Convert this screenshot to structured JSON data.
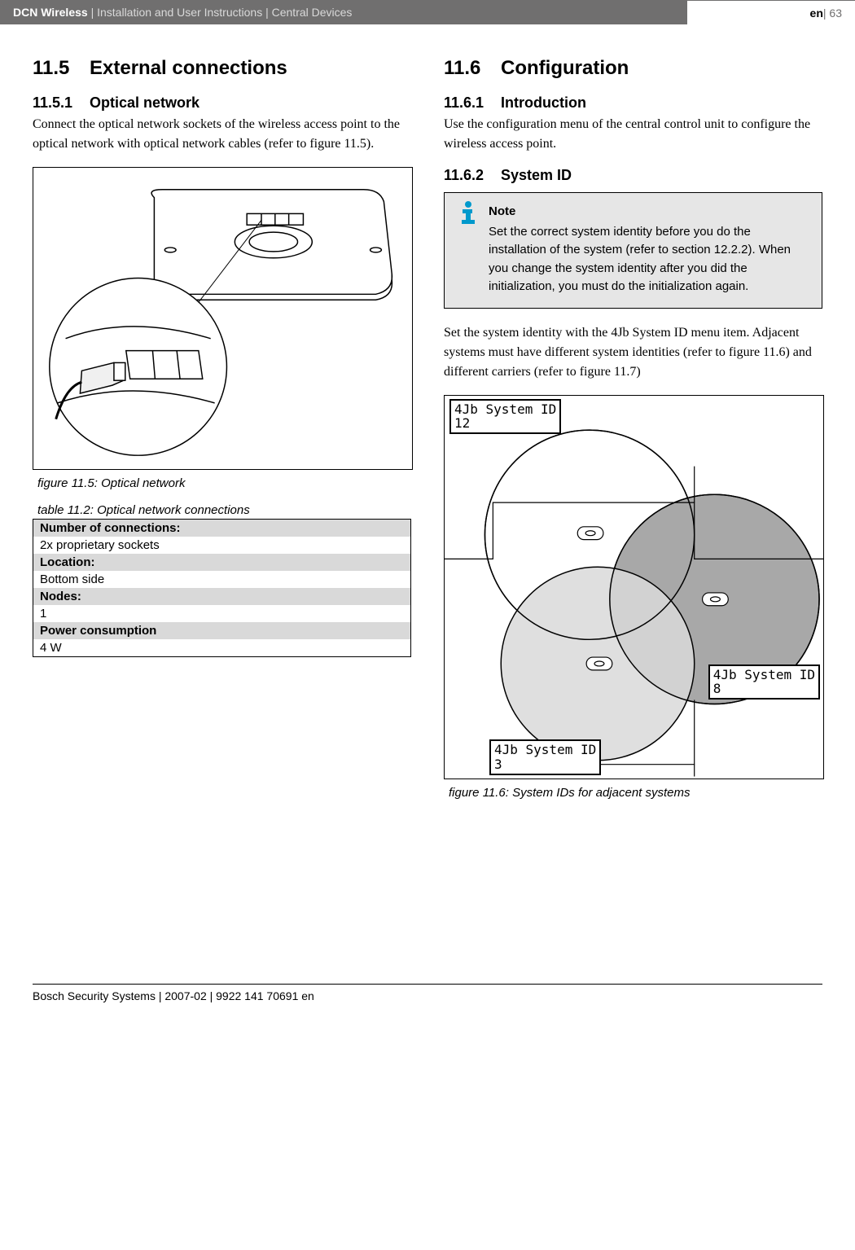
{
  "header": {
    "product": "DCN Wireless",
    "breadcrumb": " | Installation and User Instructions | Central Devices",
    "lang": "en",
    "page": " | 63"
  },
  "left": {
    "h1_num": "11.5",
    "h1_title": "External connections",
    "h2_num": "11.5.1",
    "h2_title": "Optical network",
    "p1": "Connect the optical network sockets of the wireless access point to the optical network with optical network cables (refer to figure 11.5).",
    "fig_caption": "figure 11.5: Optical network",
    "table_caption": "table 11.2: Optical network connections",
    "table_rows": [
      {
        "label": "Number of connections:",
        "value": "2x proprietary sockets"
      },
      {
        "label": "Location:",
        "value": "Bottom side"
      },
      {
        "label": "Nodes:",
        "value": "1"
      },
      {
        "label": "Power consumption",
        "value": "4 W"
      }
    ]
  },
  "right": {
    "h1_num": "11.6",
    "h1_title": "Configuration",
    "h2a_num": "11.6.1",
    "h2a_title": "Introduction",
    "p1": "Use the configuration menu of the central control unit to configure the wireless access point.",
    "h2b_num": "11.6.2",
    "h2b_title": "System ID",
    "note_label": "Note",
    "note_text": "Set the correct system identity before you do the installation of the system (refer to section 12.2.2). When you change the system identity after you did the initialization, you must do the initialization again.",
    "p2": "Set the system identity with the 4Jb System ID menu item. Adjacent systems must have different system identities (refer to figure 11.6) and different carriers (refer to figure 11.7)",
    "lcd1": "4Jb System ID\n12",
    "lcd2": "4Jb System ID\n8",
    "lcd3": "4Jb System ID\n3",
    "fig_caption": "figure 11.6: System IDs for adjacent systems"
  },
  "footer": "Bosch Security Systems | 2007-02 | 9922 141 70691 en"
}
